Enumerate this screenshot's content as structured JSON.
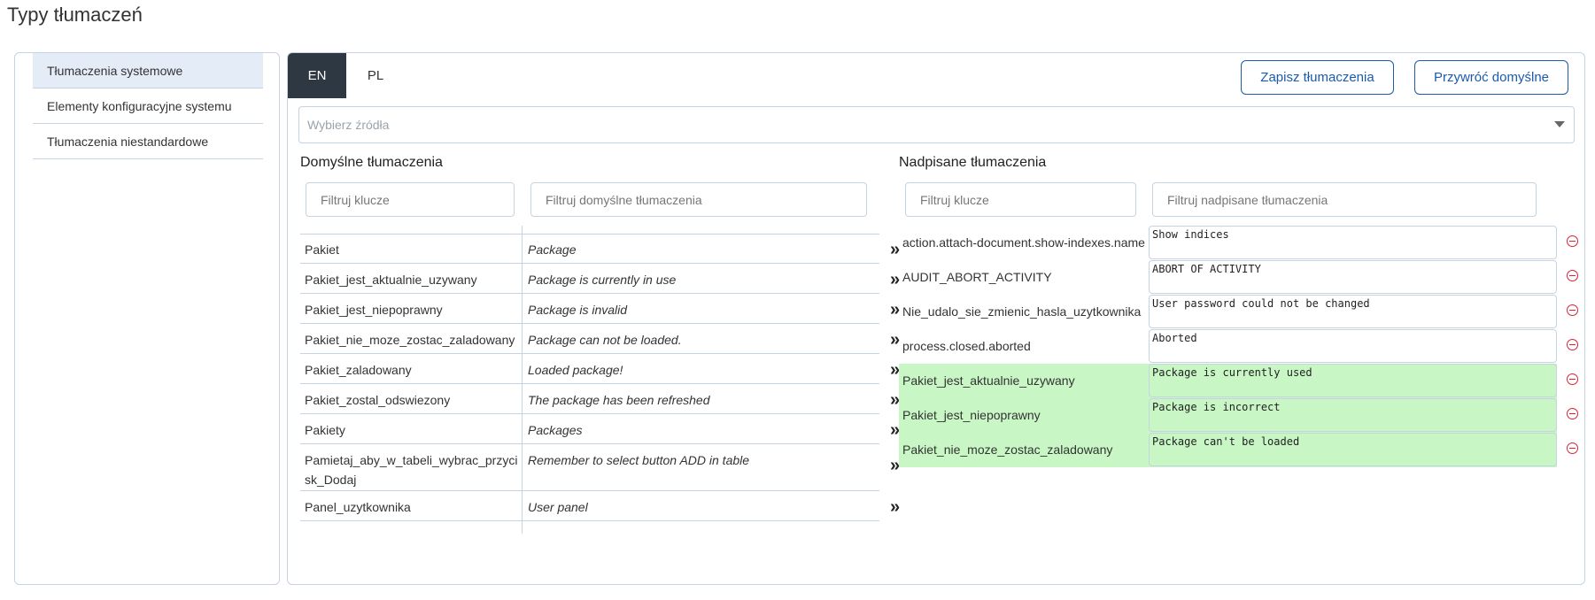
{
  "page": {
    "title": "Typy tłumaczeń"
  },
  "sidebar": {
    "items": [
      {
        "label": "Tłumaczenia systemowe",
        "active": true
      },
      {
        "label": "Elementy konfiguracyjne systemu",
        "active": false
      },
      {
        "label": "Tłumaczenia niestandardowe",
        "active": false
      }
    ]
  },
  "tabs": [
    {
      "label": "EN",
      "active": true
    },
    {
      "label": "PL",
      "active": false
    }
  ],
  "buttons": {
    "save_label": "Zapisz tłumaczenia",
    "restore_label": "Przywróć domyślne"
  },
  "source_select": {
    "placeholder": "Wybierz źródła"
  },
  "default_section": {
    "heading": "Domyślne tłumaczenia",
    "key_filter_placeholder": "Filtruj klucze",
    "value_filter_placeholder": "Filtruj domyślne tłumaczenia",
    "rows": [
      {
        "key": "Pakiet",
        "value": "Package"
      },
      {
        "key": "Pakiet_jest_aktualnie_uzywany",
        "value": "Package is currently in use"
      },
      {
        "key": "Pakiet_jest_niepoprawny",
        "value": "Package is invalid"
      },
      {
        "key": "Pakiet_nie_moze_zostac_zaladowany",
        "value": "Package can not be loaded."
      },
      {
        "key": "Pakiet_zaladowany",
        "value": "Loaded package!"
      },
      {
        "key": "Pakiet_zostal_odswiezony",
        "value": "The package has been refreshed"
      },
      {
        "key": "Pakiety",
        "value": "Packages"
      },
      {
        "key": "Pamietaj_aby_w_tabeli_wybrac_przycisk_Dodaj",
        "value": "Remember to select button ADD in table"
      },
      {
        "key": "Panel_uzytkownika",
        "value": "User panel"
      }
    ]
  },
  "override_section": {
    "heading": "Nadpisane tłumaczenia",
    "key_filter_placeholder": "Filtruj klucze",
    "value_filter_placeholder": "Filtruj nadpisane tłumaczenia",
    "rows": [
      {
        "key": "action.attach-document.show-indexes.name",
        "value": "Show indices",
        "new": false
      },
      {
        "key": "AUDIT_ABORT_ACTIVITY",
        "value": "ABORT OF ACTIVITY",
        "new": false
      },
      {
        "key": "Nie_udalo_sie_zmienic_hasla_uzytkownika",
        "value": "User password could not be changed",
        "new": false
      },
      {
        "key": "process.closed.aborted",
        "value": "Aborted",
        "new": false
      },
      {
        "key": "Pakiet_jest_aktualnie_uzywany",
        "value": "Package is currently used",
        "new": true
      },
      {
        "key": "Pakiet_jest_niepoprawny",
        "value": "Package is incorrect",
        "new": true
      },
      {
        "key": "Pakiet_nie_moze_zostac_zaladowany",
        "value": "Package can't be loaded",
        "new": true
      }
    ]
  },
  "icons": {
    "copy": "double-chevron-right-icon",
    "remove": "minus-circle-icon",
    "dropdown": "caret-down-icon"
  },
  "colors": {
    "active_tab": "#2d3843",
    "accent": "#1b5aad",
    "new_row": "#c8f7c5",
    "remove": "#dd2233"
  }
}
